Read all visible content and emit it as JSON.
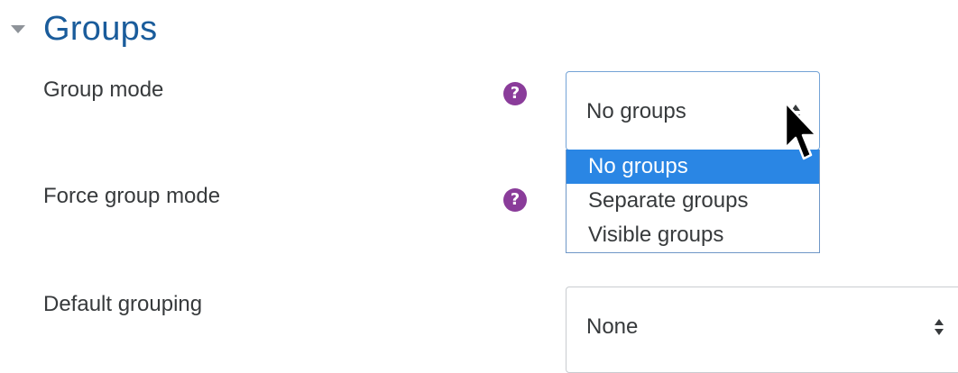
{
  "section": {
    "title": "Groups"
  },
  "fields": {
    "group_mode": {
      "label": "Group mode",
      "value": "No groups",
      "options": [
        "No groups",
        "Separate groups",
        "Visible groups"
      ],
      "help": "?"
    },
    "force_group_mode": {
      "label": "Force group mode",
      "help": "?"
    },
    "default_grouping": {
      "label": "Default grouping",
      "value": "None"
    }
  },
  "colors": {
    "title": "#1a5c9b",
    "help_icon": "#8a3c9a",
    "selected_option": "#2a86e4"
  },
  "icons": {
    "collapse": "chevron-down-icon",
    "help": "question-circle-icon",
    "select_arrows": "sort-arrows-icon",
    "cursor": "mouse-pointer-icon"
  }
}
